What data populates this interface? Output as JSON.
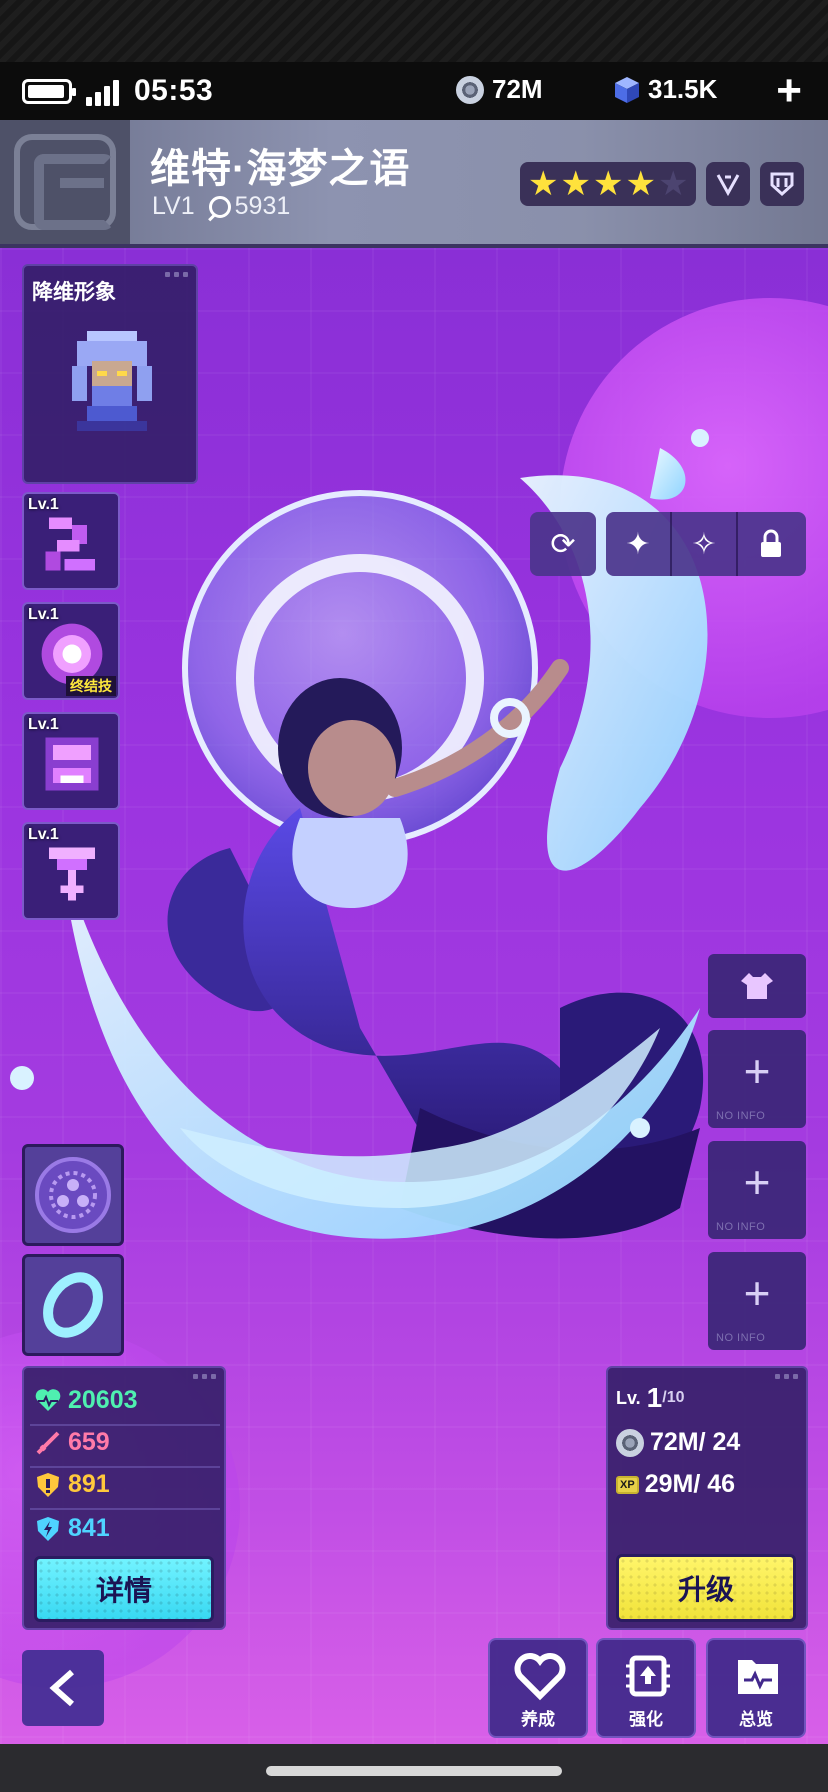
{
  "status_bar": {
    "time": "05:53",
    "coins": "72M",
    "gems": "31.5K",
    "add_symbol": "+"
  },
  "character": {
    "name": "维特·海梦之语",
    "level": "LV1",
    "power": "5931",
    "stars_filled": 4,
    "stars_total": 5
  },
  "portrait": {
    "title": "降维形象"
  },
  "skills": [
    {
      "level": "Lv.1",
      "icon": "swirl-skill-icon"
    },
    {
      "level": "Lv.1",
      "icon": "orb-skill-icon",
      "tag": "终结技"
    },
    {
      "level": "Lv.1",
      "icon": "chain-skill-icon"
    },
    {
      "level": "Lv.1",
      "icon": "trident-skill-icon"
    }
  ],
  "controls": [
    "refresh-icon",
    "sparkle-icon",
    "double-sparkle-icon",
    "lock-icon"
  ],
  "equipment_slots": [
    {
      "label": "NO INFO"
    },
    {
      "label": "NO INFO"
    },
    {
      "label": "NO INFO"
    }
  ],
  "stats": {
    "hp": "20603",
    "attack": "659",
    "defense": "891",
    "speed": "841",
    "detail_label": "详情"
  },
  "level_panel": {
    "lv_prefix": "Lv.",
    "level": "1",
    "max_level": "/10",
    "coin_cost": "72M/ 24",
    "xp_cost": "29M/ 46",
    "xp_tag": "XP",
    "upgrade_label": "升级"
  },
  "nav": {
    "cultivate": "养成",
    "enhance": "强化",
    "overview": "总览"
  },
  "colors": {
    "accent_cyan": "#38d8f2",
    "accent_yellow": "#f1e33a",
    "star": "#ffe23c",
    "hp": "#4ff0b0",
    "attack": "#ff7aa8",
    "defense": "#ffc83c",
    "speed": "#4fd4ff"
  }
}
